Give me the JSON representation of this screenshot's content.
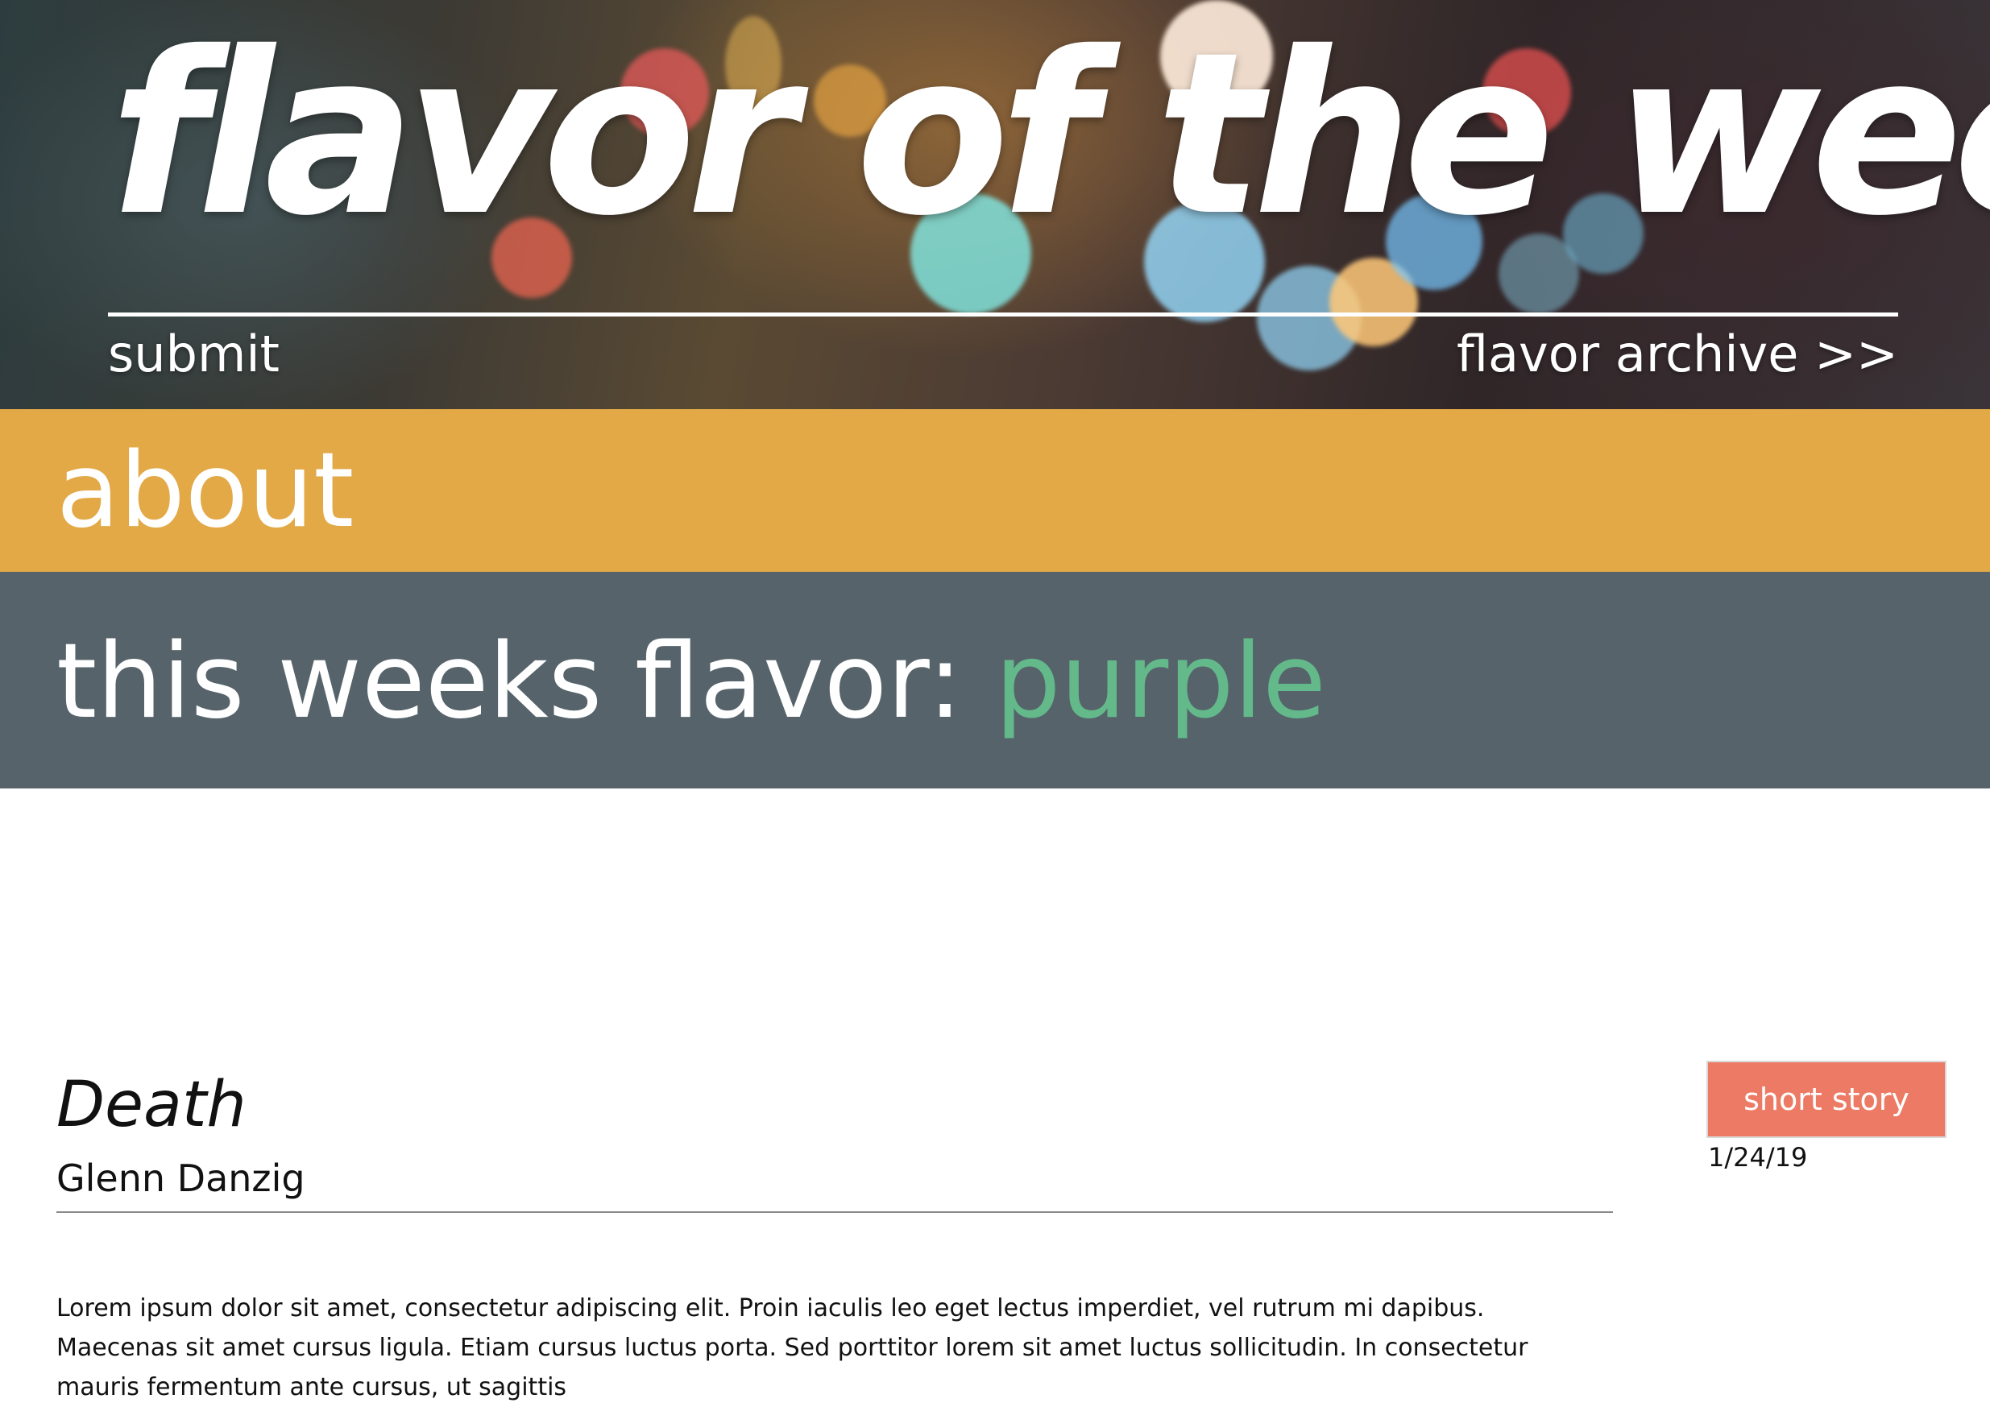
{
  "header": {
    "title": "flavor of the week",
    "submit_link": "submit",
    "archive_link": "flavor archive >>"
  },
  "about": {
    "label": "about"
  },
  "flavor_banner": {
    "prefix": "this weeks flavor: ",
    "flavor": "purple"
  },
  "article": {
    "title": "Death",
    "author": "Glenn Danzig",
    "category": "short story",
    "date": "1/24/19",
    "body": "Lorem ipsum dolor sit amet, consectetur adipiscing elit. Proin iaculis leo eget lectus imperdiet, vel rutrum mi dapibus. Maecenas sit amet cursus ligula. Etiam cursus luctus porta. Sed porttitor lorem sit amet luctus sollicitudin. In consectetur mauris fermentum ante cursus, ut sagittis"
  },
  "colors": {
    "about_band": "#e2a946",
    "flavor_band": "#56636b",
    "flavor_accent": "#63b98a",
    "tag_button": "#ec7a64"
  }
}
